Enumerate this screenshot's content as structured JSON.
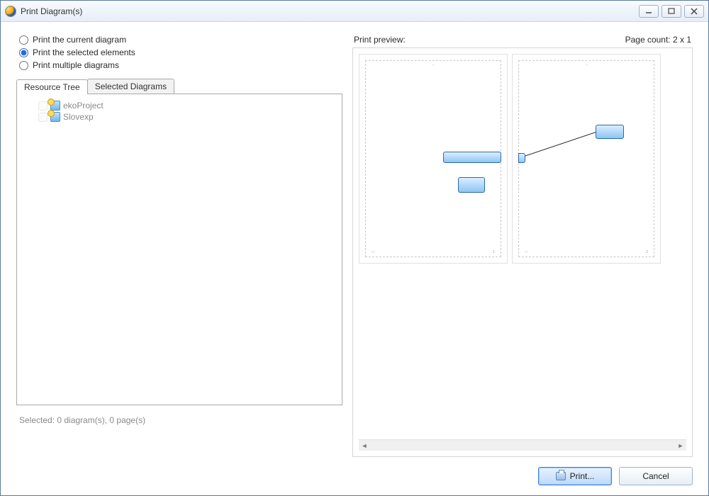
{
  "window": {
    "title": "Print Diagram(s)"
  },
  "radios": {
    "current": "Print the current diagram",
    "selected": "Print the selected elements",
    "multiple": "Print multiple diagrams",
    "checked": "selected"
  },
  "tabs": {
    "resource_tree": "Resource Tree",
    "selected_diagrams": "Selected Diagrams"
  },
  "tree": {
    "items": [
      {
        "label": "ekoProject"
      },
      {
        "label": "Slovexp"
      }
    ]
  },
  "selected_status": "Selected:  0 diagram(s), 0 page(s)",
  "preview": {
    "header_label": "Print preview:",
    "page_count_label": "Page count: 2 x 1",
    "page_footer_text": "",
    "pages": 2
  },
  "buttons": {
    "print": "Print...",
    "cancel": "Cancel"
  }
}
